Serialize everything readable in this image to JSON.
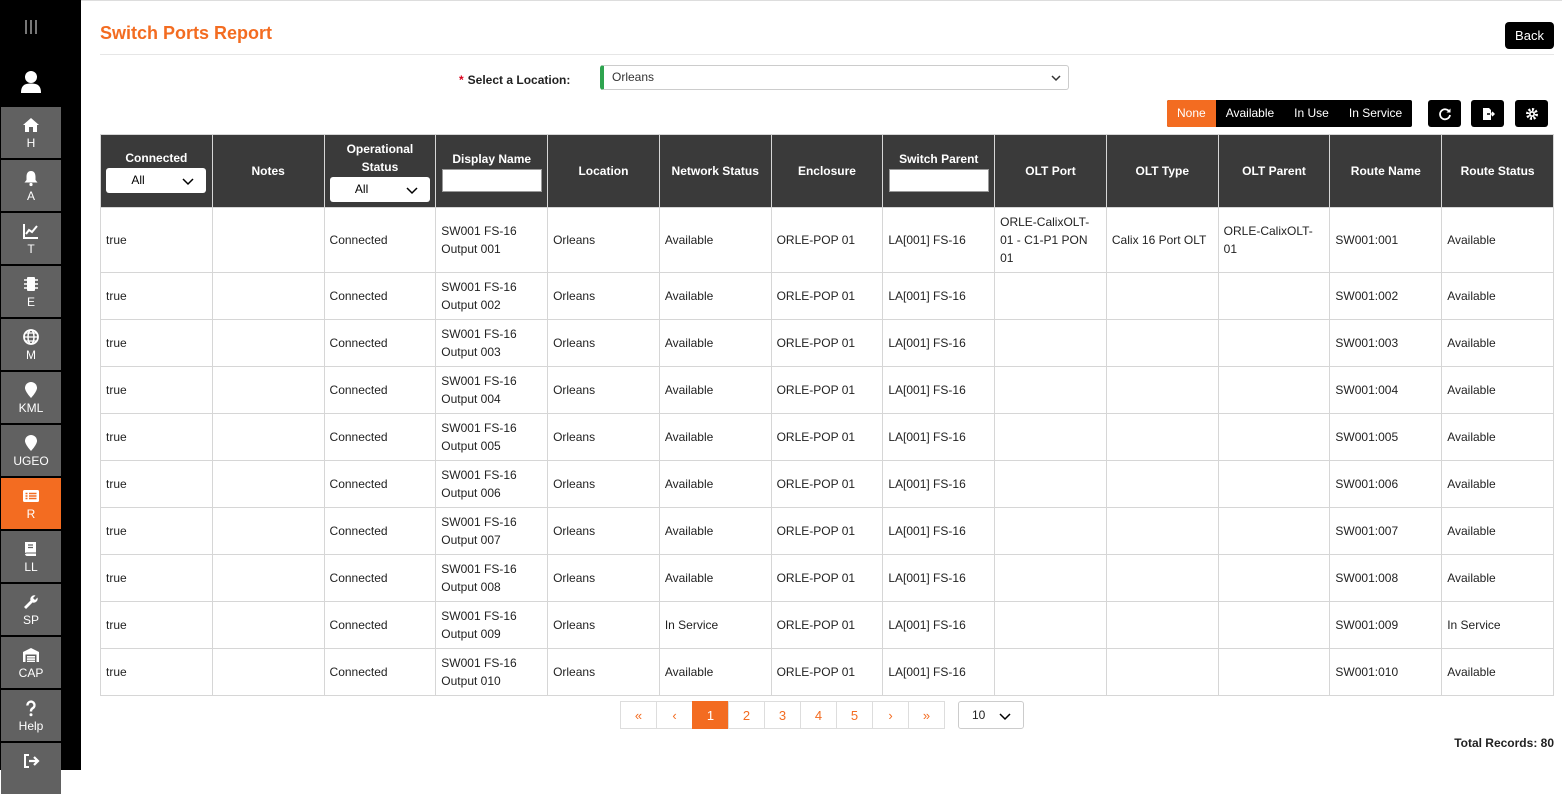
{
  "sidebar": {
    "items": [
      {
        "label": "H",
        "icon": "home-icon"
      },
      {
        "label": "A",
        "icon": "bell-icon"
      },
      {
        "label": "T",
        "icon": "chart-icon"
      },
      {
        "label": "E",
        "icon": "chip-icon"
      },
      {
        "label": "M",
        "icon": "globe-icon"
      },
      {
        "label": "KML",
        "icon": "map-pin-icon"
      },
      {
        "label": "UGEO",
        "icon": "map-pin-icon"
      },
      {
        "label": "R",
        "icon": "report-icon"
      },
      {
        "label": "LL",
        "icon": "book-icon"
      },
      {
        "label": "SP",
        "icon": "wrench-icon"
      },
      {
        "label": "CAP",
        "icon": "warehouse-icon"
      },
      {
        "label": "Help",
        "icon": "question-icon"
      },
      {
        "label": "",
        "icon": "logout-icon"
      }
    ]
  },
  "header": {
    "title": "Switch Ports Report",
    "back_label": "Back"
  },
  "location": {
    "required_mark": "*",
    "label": "Select a Location:",
    "value": "Orleans"
  },
  "filters": [
    "None",
    "Available",
    "In Use",
    "In Service"
  ],
  "table": {
    "headers": {
      "connected": "Connected",
      "connected_filter": "All",
      "notes": "Notes",
      "op_status": "Operational Status",
      "op_status_filter": "All",
      "display_name": "Display Name",
      "location": "Location",
      "network_status": "Network Status",
      "enclosure": "Enclosure",
      "switch_parent": "Switch Parent",
      "olt_port": "OLT Port",
      "olt_type": "OLT Type",
      "olt_parent": "OLT Parent",
      "route_name": "Route Name",
      "route_status": "Route Status"
    },
    "rows": [
      {
        "connected": "true",
        "notes": "",
        "op_status": "Connected",
        "display_name": "SW001 FS-16 Output 001",
        "location": "Orleans",
        "network_status": "Available",
        "enclosure": "ORLE-POP 01",
        "switch_parent": "LA[001] FS-16",
        "olt_port": "ORLE-CalixOLT-01 - C1-P1 PON 01",
        "olt_type": "Calix 16 Port OLT",
        "olt_parent": "ORLE-CalixOLT-01",
        "route_name": "SW001:001",
        "route_status": "Available"
      },
      {
        "connected": "true",
        "notes": "",
        "op_status": "Connected",
        "display_name": "SW001 FS-16 Output 002",
        "location": "Orleans",
        "network_status": "Available",
        "enclosure": "ORLE-POP 01",
        "switch_parent": "LA[001] FS-16",
        "olt_port": "",
        "olt_type": "",
        "olt_parent": "",
        "route_name": "SW001:002",
        "route_status": "Available"
      },
      {
        "connected": "true",
        "notes": "",
        "op_status": "Connected",
        "display_name": "SW001 FS-16 Output 003",
        "location": "Orleans",
        "network_status": "Available",
        "enclosure": "ORLE-POP 01",
        "switch_parent": "LA[001] FS-16",
        "olt_port": "",
        "olt_type": "",
        "olt_parent": "",
        "route_name": "SW001:003",
        "route_status": "Available"
      },
      {
        "connected": "true",
        "notes": "",
        "op_status": "Connected",
        "display_name": "SW001 FS-16 Output 004",
        "location": "Orleans",
        "network_status": "Available",
        "enclosure": "ORLE-POP 01",
        "switch_parent": "LA[001] FS-16",
        "olt_port": "",
        "olt_type": "",
        "olt_parent": "",
        "route_name": "SW001:004",
        "route_status": "Available"
      },
      {
        "connected": "true",
        "notes": "",
        "op_status": "Connected",
        "display_name": "SW001 FS-16 Output 005",
        "location": "Orleans",
        "network_status": "Available",
        "enclosure": "ORLE-POP 01",
        "switch_parent": "LA[001] FS-16",
        "olt_port": "",
        "olt_type": "",
        "olt_parent": "",
        "route_name": "SW001:005",
        "route_status": "Available"
      },
      {
        "connected": "true",
        "notes": "",
        "op_status": "Connected",
        "display_name": "SW001 FS-16 Output 006",
        "location": "Orleans",
        "network_status": "Available",
        "enclosure": "ORLE-POP 01",
        "switch_parent": "LA[001] FS-16",
        "olt_port": "",
        "olt_type": "",
        "olt_parent": "",
        "route_name": "SW001:006",
        "route_status": "Available"
      },
      {
        "connected": "true",
        "notes": "",
        "op_status": "Connected",
        "display_name": "SW001 FS-16 Output 007",
        "location": "Orleans",
        "network_status": "Available",
        "enclosure": "ORLE-POP 01",
        "switch_parent": "LA[001] FS-16",
        "olt_port": "",
        "olt_type": "",
        "olt_parent": "",
        "route_name": "SW001:007",
        "route_status": "Available"
      },
      {
        "connected": "true",
        "notes": "",
        "op_status": "Connected",
        "display_name": "SW001 FS-16 Output 008",
        "location": "Orleans",
        "network_status": "Available",
        "enclosure": "ORLE-POP 01",
        "switch_parent": "LA[001] FS-16",
        "olt_port": "",
        "olt_type": "",
        "olt_parent": "",
        "route_name": "SW001:008",
        "route_status": "Available"
      },
      {
        "connected": "true",
        "notes": "",
        "op_status": "Connected",
        "display_name": "SW001 FS-16 Output 009",
        "location": "Orleans",
        "network_status": "In Service",
        "enclosure": "ORLE-POP 01",
        "switch_parent": "LA[001] FS-16",
        "olt_port": "",
        "olt_type": "",
        "olt_parent": "",
        "route_name": "SW001:009",
        "route_status": "In Service"
      },
      {
        "connected": "true",
        "notes": "",
        "op_status": "Connected",
        "display_name": "SW001 FS-16 Output 010",
        "location": "Orleans",
        "network_status": "Available",
        "enclosure": "ORLE-POP 01",
        "switch_parent": "LA[001] FS-16",
        "olt_port": "",
        "olt_type": "",
        "olt_parent": "",
        "route_name": "SW001:010",
        "route_status": "Available"
      }
    ]
  },
  "pagination": {
    "first": "«",
    "prev": "‹",
    "pages": [
      "1",
      "2",
      "3",
      "4",
      "5"
    ],
    "current": "1",
    "next": "›",
    "last": "»",
    "page_size": "10"
  },
  "footer": {
    "total_records": "Total Records: 80"
  },
  "colors": {
    "accent": "#f36c21",
    "sidebar_bg": "#000000",
    "sidebar_item": "#616161",
    "header_bg": "#3a3a3a",
    "location_indicator": "#2ea44f"
  }
}
